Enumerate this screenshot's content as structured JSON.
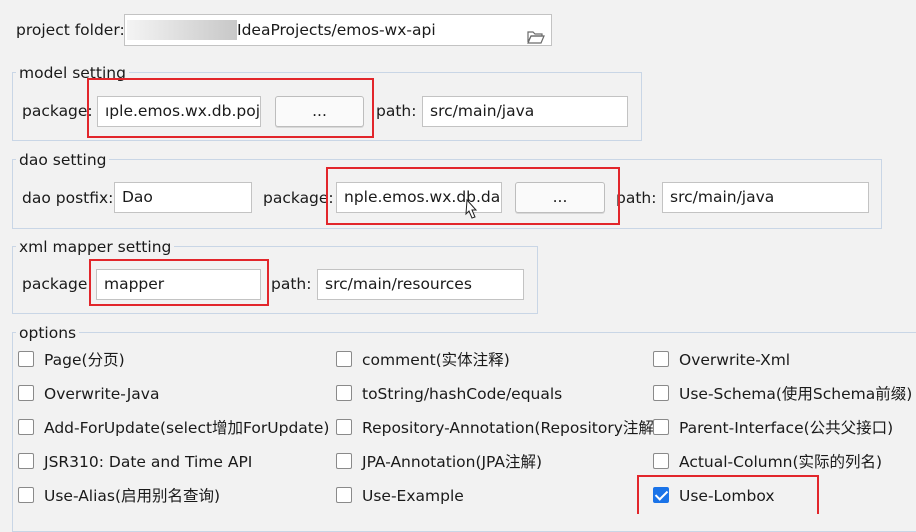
{
  "project": {
    "label": "project folder:",
    "path": "IdeaProjects/emos-wx-api",
    "folder_icon": "folder-open-icon"
  },
  "model_setting": {
    "title": "model setting",
    "package_label": "package:",
    "package_value": "ıple.emos.wx.db.pojo",
    "browse_label": "...",
    "path_label": "path:",
    "path_value": "src/main/java"
  },
  "dao_setting": {
    "title": "dao setting",
    "postfix_label": "dao postfix:",
    "postfix_value": "Dao",
    "package_label": "package:",
    "package_value": "nple.emos.wx.db.dao",
    "browse_label": "...",
    "path_label": "path:",
    "path_value": "src/main/java"
  },
  "xml_mapper_setting": {
    "title": "xml mapper setting",
    "package_label": "package:",
    "package_value": "mapper",
    "path_label": "path:",
    "path_value": "src/main/resources"
  },
  "options": {
    "title": "options",
    "items": [
      {
        "label": "Page(分页)",
        "checked": false
      },
      {
        "label": "comment(实体注释)",
        "checked": false
      },
      {
        "label": "Overwrite-Xml",
        "checked": false
      },
      {
        "label": "Overwrite-Java",
        "checked": false
      },
      {
        "label": "toString/hashCode/equals",
        "checked": false
      },
      {
        "label": "Use-Schema(使用Schema前缀)",
        "checked": false
      },
      {
        "label": "Add-ForUpdate(select增加ForUpdate)",
        "checked": false
      },
      {
        "label": "Repository-Annotation(Repository注解)",
        "checked": false
      },
      {
        "label": "Parent-Interface(公共父接口)",
        "checked": false
      },
      {
        "label": "JSR310: Date and Time API",
        "checked": false
      },
      {
        "label": "JPA-Annotation(JPA注解)",
        "checked": false
      },
      {
        "label": "Actual-Column(实际的列名)",
        "checked": false
      },
      {
        "label": "Use-Alias(启用别名查询)",
        "checked": false
      },
      {
        "label": "Use-Example",
        "checked": false
      },
      {
        "label": "Use-Lombox",
        "checked": true
      }
    ]
  },
  "colors": {
    "highlight_border": "#e2262b",
    "group_border": "#c9d6e6",
    "checkbox_checked": "#1a73e8"
  }
}
